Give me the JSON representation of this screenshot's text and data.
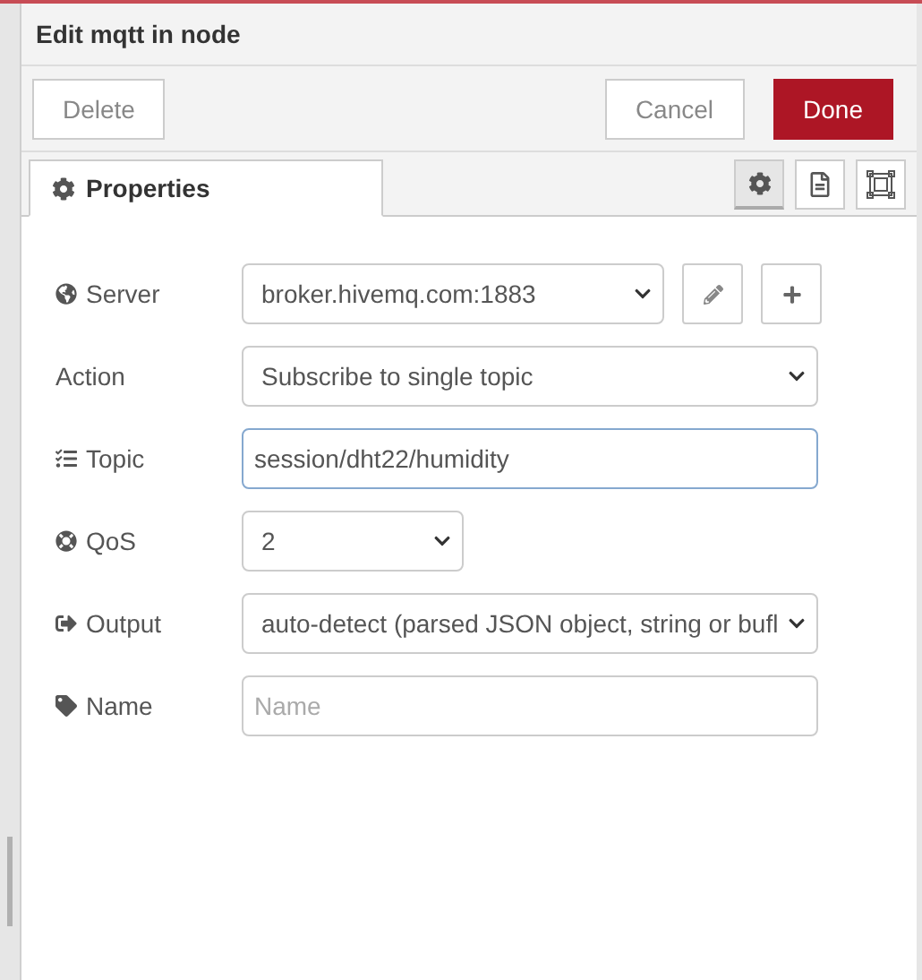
{
  "window": {
    "title": "Edit mqtt in node"
  },
  "buttons": {
    "delete": "Delete",
    "cancel": "Cancel",
    "done": "Done"
  },
  "tabs": [
    {
      "label": "Properties",
      "selected": true
    }
  ],
  "tab_buttons": [
    {
      "selected": true
    },
    {
      "selected": false
    },
    {
      "selected": false
    }
  ],
  "fields": [
    {
      "label": "Server",
      "kind": "select-with-buttons",
      "value": "broker.hivemq.com:1883"
    },
    {
      "label": "Action",
      "kind": "select",
      "value": "Subscribe to single topic"
    },
    {
      "label": "Topic",
      "kind": "input",
      "value": "session/dht22/humidity",
      "focused": true
    },
    {
      "label": "QoS",
      "kind": "small-select",
      "value": "2"
    },
    {
      "label": "Output",
      "kind": "select",
      "value": "auto-detect (parsed JSON object, string or bufl"
    },
    {
      "label": "Name",
      "kind": "input",
      "placeholder": "Name",
      "focused": false
    }
  ]
}
